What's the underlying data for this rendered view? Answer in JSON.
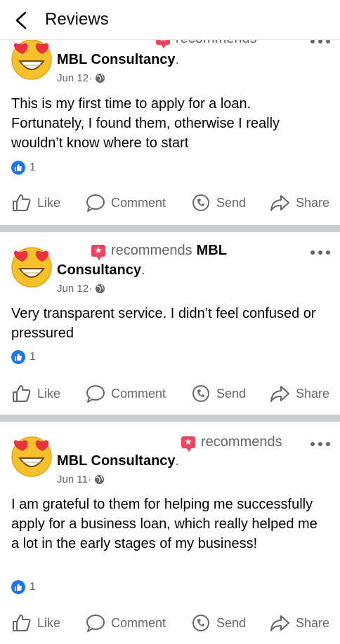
{
  "header": {
    "title": "Reviews"
  },
  "posts": [
    {
      "recommends_text": "recommends",
      "page_name": "MBL Consultancy",
      "name_suffix": ".",
      "date": "Jun 12",
      "date_sep": " ·",
      "text": "This is my first time to apply for a loan. Fortunately, I found them, otherwise I really wouldn’t know where to start",
      "reaction_count": "1"
    },
    {
      "recommends_text": "recommends",
      "page_name_line1": "MBL",
      "page_name_line2": "Consultancy",
      "name_suffix": ".",
      "date": "Jun 12",
      "date_sep": " ·",
      "text": "Very transparent service. I didn’t feel confused or pressured",
      "reaction_count": "1"
    },
    {
      "recommends_text": "recommends",
      "page_name": "MBL Consultancy",
      "name_suffix": ".",
      "date": "Jun 11",
      "date_sep": " ·",
      "text": "I am grateful to them for helping me successfully apply for a business loan, which really helped me a lot in the early stages of my business!",
      "reaction_count": "1"
    }
  ],
  "actions": {
    "like": "Like",
    "comment": "Comment",
    "send": "Send",
    "share": "Share"
  },
  "colors": {
    "brand_blue": "#1877f2",
    "recommend_red": "#f3425f",
    "secondary_text": "#65676b",
    "divider": "#c9ccd1"
  },
  "icons": [
    "back-arrow-icon",
    "recommend-icon",
    "globe-icon",
    "more-icon",
    "like-icon",
    "comment-icon",
    "send-icon",
    "share-icon"
  ]
}
